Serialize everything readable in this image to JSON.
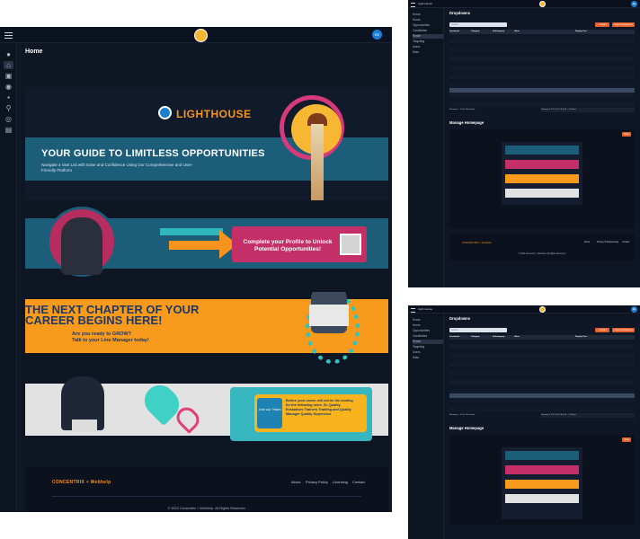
{
  "main": {
    "page_title": "Home",
    "avatar_initials": "EE",
    "rail_icons": [
      "user-icon",
      "home-icon",
      "briefcase-icon",
      "eye-icon",
      "folder-icon",
      "search-icon",
      "target-icon",
      "database-icon"
    ],
    "banner1": {
      "brand": "LIGHTHOUSE",
      "headline": "YOUR GUIDE TO LIMITLESS OPPORTUNITIES",
      "subtext": "Navigate a Vast List with Ease and Confidence Using Our Comprehensive and User-Friendly Platform"
    },
    "banner2": {
      "cta": "Complete your Profile to Unlock Potential Opportunities!"
    },
    "banner3": {
      "headline_line1": "THE NEXT CHAPTER OF YOUR",
      "headline_line2": "CAREER BEGINS HERE!",
      "sub_line1": "Are you ready to GROW?",
      "sub_line2": "Talk to your Line Manager today!"
    },
    "banner4": {
      "badge": "Join our Team",
      "text": "Before your career will not be the looking for the following roles: Sr. Quality Evaluators Trainers Training and Quality Manager Quality Supervisor"
    },
    "footer": {
      "brand": "CONCENTRIX + Webhelp",
      "links": [
        "About",
        "Privacy Policy",
        "Licensing",
        "Contact"
      ],
      "copyright": "© 2023 Concentrix + Webhelp. All Rights Reserved."
    }
  },
  "mini_windows": [
    {
      "app_title": "Light House",
      "avatar_initials": "EE",
      "sidebar": [
        "Home",
        "Home",
        "Opportunities",
        "Candidates",
        "Roster",
        "Targeting",
        "Users",
        "Data"
      ],
      "active_index": 4,
      "section_title": "Dropdowns",
      "search_placeholder": "Search",
      "buttons": [
        "+ Import",
        "Import Dropdowns"
      ],
      "table": {
        "headers": [
          "Functional",
          "Category",
          "Subcategory",
          "Value",
          "Display Text"
        ],
        "rows": 16
      },
      "pager_left": "Showing 1 - 10 of 160 results",
      "pager_right": "Previous 1 2 3 4 5 6 7 8 9 10 ... 16 Next",
      "manage_title": "Manage Homepage",
      "save_label": "Save"
    },
    {
      "app_title": "Light House",
      "avatar_initials": "EE",
      "sidebar": [
        "Home",
        "Home",
        "Opportunities",
        "Candidates",
        "Roster",
        "Targeting",
        "Users",
        "Data"
      ],
      "active_index": 4,
      "section_title": "Dropdowns",
      "search_placeholder": "Search",
      "buttons": [
        "+ Import",
        "Import Dropdowns"
      ],
      "table": {
        "headers": [
          "Functional",
          "Category",
          "Subcategory",
          "Value",
          "Display Text"
        ],
        "rows": 16
      },
      "pager_left": "Showing 1 - 10 of 160 results",
      "pager_right": "Previous 1 2 3 4 5 6 7 8 9 10 ... 16 Next",
      "manage_title": "Manage Homepage",
      "save_label": "Save"
    }
  ],
  "colors": {
    "bg": "#0e1624",
    "accent_orange": "#f7941d",
    "teal": "#1c5d7a",
    "pink": "#c42f68",
    "cta_orange": "#e8622c"
  }
}
